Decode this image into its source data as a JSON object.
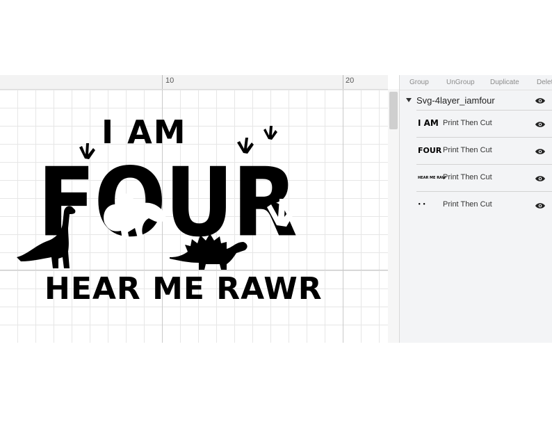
{
  "ruler": {
    "marks": [
      "10",
      "20"
    ]
  },
  "artwork": {
    "line1": "I AM",
    "line2": "FOUR",
    "line3": "HEAR ME RAWR"
  },
  "panel": {
    "toolbar": [
      "Group",
      "UnGroup",
      "Duplicate",
      "Delet"
    ],
    "group_name": "Svg-4layer_iamfour",
    "layers": [
      {
        "thumb": "I AM",
        "label": "Print Then Cut"
      },
      {
        "thumb": "FOUR",
        "label": "Print Then Cut"
      },
      {
        "thumb": "HEAR ME RAW",
        "label": "Print Then Cut"
      },
      {
        "thumb": "• •",
        "label": "Print Then Cut"
      }
    ]
  },
  "colors": {
    "ink": "#000000",
    "panel_bg": "#f3f4f6",
    "grid": "#e6e6e6"
  }
}
